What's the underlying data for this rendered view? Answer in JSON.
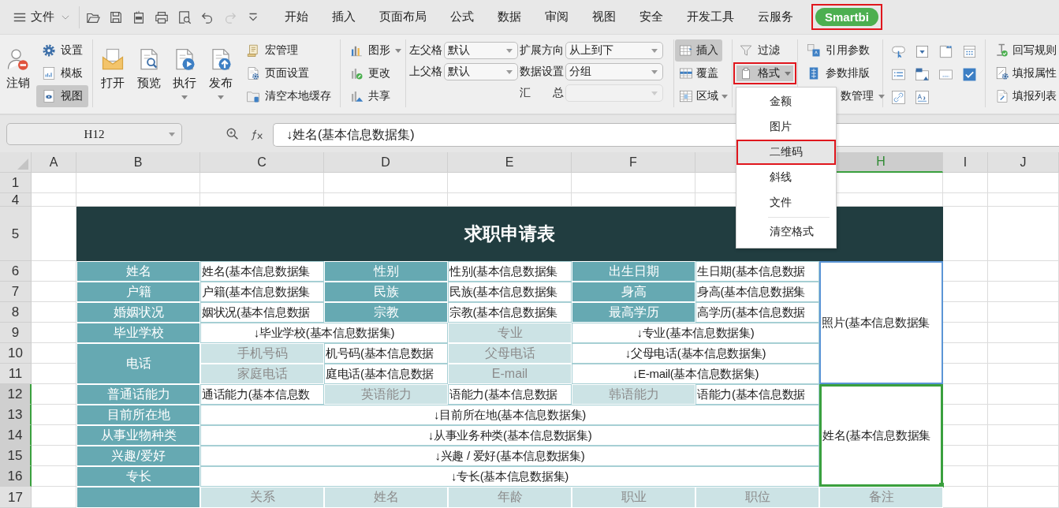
{
  "menubar": {
    "file_menu": "文件",
    "quick_access": {
      "undo": {
        "disabled": false
      },
      "redo": {
        "disabled": true
      }
    },
    "tabs": [
      {
        "label": "开始",
        "selected": false,
        "marked": false
      },
      {
        "label": "插入",
        "selected": false,
        "marked": false
      },
      {
        "label": "页面布局",
        "selected": false,
        "marked": false
      },
      {
        "label": "公式",
        "selected": false,
        "marked": false
      },
      {
        "label": "数据",
        "selected": false,
        "marked": false
      },
      {
        "label": "审阅",
        "selected": false,
        "marked": false
      },
      {
        "label": "视图",
        "selected": false,
        "marked": false
      },
      {
        "label": "安全",
        "selected": false,
        "marked": false
      },
      {
        "label": "开发工具",
        "selected": false,
        "marked": false
      },
      {
        "label": "云服务",
        "selected": false,
        "marked": false
      },
      {
        "label": "Smartbi",
        "selected": true,
        "marked": true
      }
    ]
  },
  "ribbon": {
    "account": {
      "logout": "注销",
      "small": [
        {
          "label": "设置",
          "pressed": false
        },
        {
          "label": "模板",
          "pressed": false
        },
        {
          "label": "视图",
          "pressed": true
        }
      ]
    },
    "report": {
      "large": [
        {
          "label": "打开",
          "dropdown": false
        },
        {
          "label": "预览",
          "dropdown": false
        },
        {
          "label": "执行",
          "dropdown": true
        },
        {
          "label": "发布",
          "dropdown": true
        }
      ],
      "small": [
        "宏管理",
        "页面设置",
        "清空本地缓存"
      ]
    },
    "chart": [
      {
        "label": "图形",
        "dropdown": true
      },
      {
        "label": "更改",
        "dropdown": false
      },
      {
        "label": "共享",
        "dropdown": false
      }
    ],
    "cell_fields": [
      {
        "label": "左父格",
        "value": "默认",
        "disabled": false
      },
      {
        "label": "上父格",
        "value": "默认",
        "disabled": false
      },
      {
        "label": "扩展方向",
        "value": "从上到下",
        "disabled": false
      },
      {
        "label": "数据设置",
        "value": "分组",
        "disabled": false
      },
      {
        "label": "汇 总",
        "disabled": true
      }
    ],
    "insert": [
      {
        "label": "插入",
        "pressed": true,
        "dropdown": false
      },
      {
        "label": "覆盖",
        "pressed": false,
        "dropdown": false
      },
      {
        "label": "区域",
        "pressed": false,
        "dropdown": true
      }
    ],
    "format": [
      {
        "label": "过滤",
        "pressed": false,
        "dropdown": false,
        "marked": false
      },
      {
        "label": "格式",
        "pressed": true,
        "dropdown": true,
        "marked": true
      }
    ],
    "params": [
      {
        "label": "引用参数",
        "dropdown": false
      },
      {
        "label": "参数排版",
        "dropdown": false
      },
      {
        "label": "数管理",
        "dropdown": true
      }
    ],
    "writeback": [
      "回写规则",
      "填报属性",
      "填报列表"
    ]
  },
  "formula_bar": {
    "cell": "H12",
    "formula": "↓姓名(基本信息数据集)"
  },
  "format_menu": {
    "sections": [
      {
        "items": [
          {
            "label": "金额",
            "selected": false,
            "marked": false
          },
          {
            "label": "图片",
            "selected": false,
            "marked": false
          },
          {
            "label": "二维码",
            "selected": true,
            "marked": true
          },
          {
            "label": "斜线",
            "selected": false,
            "marked": false
          },
          {
            "label": "文件",
            "selected": false,
            "marked": false
          }
        ]
      },
      {
        "items": [
          {
            "label": "清空格式",
            "selected": false,
            "marked": false
          }
        ]
      }
    ]
  },
  "sheet": {
    "columns": [
      {
        "label": "A",
        "selected": false
      },
      {
        "label": "B",
        "selected": false
      },
      {
        "label": "C",
        "selected": false
      },
      {
        "label": "D",
        "selected": false
      },
      {
        "label": "E",
        "selected": false
      },
      {
        "label": "F",
        "selected": false
      },
      {
        "label": "H",
        "selected": true
      },
      {
        "label": "I",
        "selected": false
      },
      {
        "label": "J",
        "selected": false
      }
    ],
    "rows": [
      {
        "number": "1",
        "selected": false
      },
      {
        "number": "4",
        "selected": false
      },
      {
        "number": "5",
        "selected": false
      },
      {
        "number": "6",
        "selected": false
      },
      {
        "number": "7",
        "selected": false
      },
      {
        "number": "8",
        "selected": false
      },
      {
        "number": "9",
        "selected": false
      },
      {
        "number": "10",
        "selected": false
      },
      {
        "number": "11",
        "selected": false
      },
      {
        "number": "12",
        "selected": true
      },
      {
        "number": "13",
        "selected": true
      },
      {
        "number": "14",
        "selected": true
      },
      {
        "number": "15",
        "selected": true
      },
      {
        "number": "16",
        "selected": true
      },
      {
        "number": "17",
        "selected": false
      }
    ],
    "title": "求职申请表",
    "cells": [
      {
        "kind": "label",
        "text": "姓名",
        "selected": false
      },
      {
        "kind": "value",
        "text": "姓名(基本信息数据集",
        "selected": false
      },
      {
        "kind": "label",
        "text": "性别",
        "selected": false
      },
      {
        "kind": "value",
        "text": "性别(基本信息数据集",
        "selected": false
      },
      {
        "kind": "label",
        "text": "出生日期",
        "selected": false
      },
      {
        "kind": "value",
        "text": "生日期(基本信息数据",
        "selected": false
      },
      {
        "kind": "image",
        "text": "照片(基本信息数据集",
        "selected": false
      },
      {
        "kind": "label",
        "text": "户籍",
        "selected": false
      },
      {
        "kind": "value",
        "text": "户籍(基本信息数据集",
        "selected": false
      },
      {
        "kind": "label",
        "text": "民族",
        "selected": false
      },
      {
        "kind": "value",
        "text": "民族(基本信息数据集",
        "selected": false
      },
      {
        "kind": "label",
        "text": "身高",
        "selected": false
      },
      {
        "kind": "value",
        "text": "身高(基本信息数据集",
        "selected": false
      },
      {
        "kind": "label",
        "text": "婚姻状况",
        "selected": false
      },
      {
        "kind": "value",
        "text": "姻状况(基本信息数据",
        "selected": false
      },
      {
        "kind": "label",
        "text": "宗教",
        "selected": false
      },
      {
        "kind": "value",
        "text": "宗教(基本信息数据集",
        "selected": false
      },
      {
        "kind": "label",
        "text": "最高学历",
        "selected": false
      },
      {
        "kind": "value",
        "text": "高学历(基本信息数据",
        "selected": false
      },
      {
        "kind": "label",
        "text": "毕业学校",
        "selected": false
      },
      {
        "kind": "value",
        "text": "↓毕业学校(基本信息数据集)",
        "selected": false
      },
      {
        "kind": "sublabel",
        "text": "专业",
        "selected": false
      },
      {
        "kind": "value",
        "text": "↓专业(基本信息数据集)",
        "selected": false
      },
      {
        "kind": "label",
        "text": "电话",
        "selected": false
      },
      {
        "kind": "sublabel",
        "text": "手机号码",
        "selected": false
      },
      {
        "kind": "value",
        "text": "机号码(基本信息数据",
        "selected": false
      },
      {
        "kind": "sublabel",
        "text": "父母电话",
        "selected": false
      },
      {
        "kind": "value",
        "text": "↓父母电话(基本信息数据集)",
        "selected": false
      },
      {
        "kind": "sublabel",
        "text": "家庭电话",
        "selected": false
      },
      {
        "kind": "value",
        "text": "庭电话(基本信息数据",
        "selected": false
      },
      {
        "kind": "sublabel",
        "text": "E-mail",
        "selected": false
      },
      {
        "kind": "value",
        "text": "↓E-mail(基本信息数据集)",
        "selected": false
      },
      {
        "kind": "label",
        "text": "普通话能力",
        "selected": false
      },
      {
        "kind": "value",
        "text": "通话能力(基本信息数",
        "selected": false
      },
      {
        "kind": "sublabel",
        "text": "英语能力",
        "selected": false
      },
      {
        "kind": "value",
        "text": "语能力(基本信息数据",
        "selected": false
      },
      {
        "kind": "sublabel",
        "text": "韩语能力",
        "selected": false
      },
      {
        "kind": "value",
        "text": "语能力(基本信息数据",
        "selected": false
      },
      {
        "kind": "value",
        "text": "姓名(基本信息数据集",
        "selected": true
      },
      {
        "kind": "label",
        "text": "目前所在地",
        "selected": false
      },
      {
        "kind": "value",
        "text": "↓目前所在地(基本信息数据集)",
        "selected": false
      },
      {
        "kind": "label",
        "text": "从事业物种类",
        "selected": false
      },
      {
        "kind": "value",
        "text": "↓从事业务种类(基本信息数据集)",
        "selected": false
      },
      {
        "kind": "label",
        "text": "兴趣/爱好",
        "selected": false
      },
      {
        "kind": "value",
        "text": "↓兴趣 / 爱好(基本信息数据集)",
        "selected": false
      },
      {
        "kind": "label",
        "text": "专长",
        "selected": false
      },
      {
        "kind": "value",
        "text": "↓专长(基本信息数据集)",
        "selected": false
      },
      {
        "kind": "label",
        "selected": false
      },
      {
        "kind": "sublabel",
        "text": "关系",
        "selected": false
      },
      {
        "kind": "sublabel",
        "text": "姓名",
        "selected": false
      },
      {
        "kind": "sublabel",
        "text": "年龄",
        "selected": false
      },
      {
        "kind": "sublabel",
        "text": "职业",
        "selected": false
      },
      {
        "kind": "sublabel",
        "text": "职位",
        "selected": false
      },
      {
        "kind": "sublabel",
        "text": "备注",
        "selected": false
      }
    ]
  }
}
